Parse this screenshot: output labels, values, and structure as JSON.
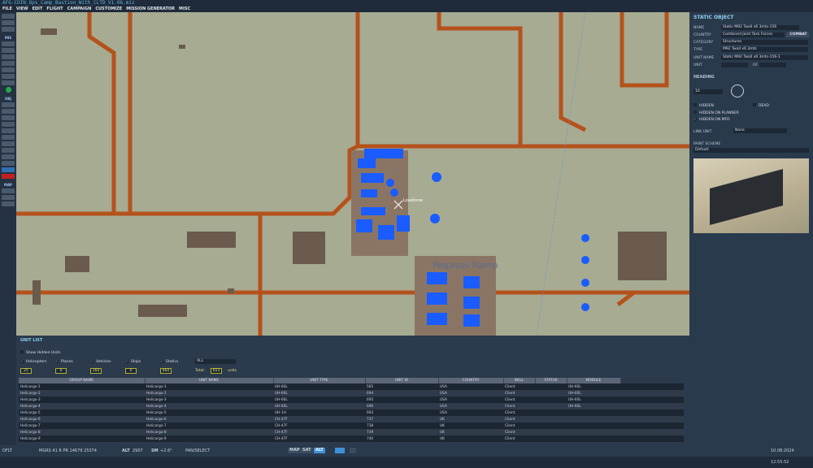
{
  "title": "AFG-COIN_Ops_Camp_Bastion_With_CLTD_V1.06.miz",
  "menu": [
    "FILE",
    "VIEW",
    "EDIT",
    "FLIGHT",
    "CAMPAIGN",
    "CUSTOMIZE",
    "MISSION GENERATOR",
    "MISC"
  ],
  "toolbar": {
    "mis_label": "MIS",
    "obj_label": "OBJ",
    "map_label": "MAP"
  },
  "map": {
    "zone_label": "Loadzone",
    "ramp_label": "Pegasus Ramp"
  },
  "static_object": {
    "title": "STATIC OBJECT",
    "name_label": "NAME",
    "name": "Static M92 Twall x6 3mts-156",
    "country_label": "COUNTRY",
    "country": "Combined Joint Task Forces",
    "combat_button": "COMBAT",
    "category_label": "CATEGORY",
    "category": "Structures",
    "type_label": "TYPE",
    "type": "M92 Twall x6 3mts",
    "unit_name_label": "UNIT NAME",
    "unit_name": "Static M92 Twall x6 3mts-156-1",
    "unit_label": "UNIT",
    "of_label": "OF",
    "heading_label": "HEADING",
    "heading": "10",
    "hidden_label": "HIDDEN",
    "dead_label": "DEAD",
    "hidden_planner_label": "HIDDEN ON PLANNER",
    "hidden_mfd_label": "HIDDEN ON MFD",
    "link_unit_label": "LINK UNIT",
    "link_unit": "None",
    "paint_label": "PAINT SCHEME",
    "paint": "Default"
  },
  "unit_list": {
    "title": "UNIT LIST",
    "show_hidden": "Show Hidden Units",
    "filters": [
      {
        "label": "Helicopters",
        "count": "25"
      },
      {
        "label": "Planes",
        "count": "0"
      },
      {
        "label": "Vehicles",
        "count": "164"
      },
      {
        "label": "Ships",
        "count": "0"
      },
      {
        "label": "Statics",
        "count": "464"
      }
    ],
    "coalition": "ALL",
    "total_label": "Total:",
    "total": "653",
    "units_label": "units",
    "columns": [
      "GROUP NAME",
      "UNIT NAME",
      "UNIT TYPE",
      "UNIT ID",
      "COUNTRY",
      "SKILL",
      "STATUS",
      "MODULE"
    ],
    "rows": [
      [
        "Helicargo-1",
        "Helicargo-1",
        "UH-60L",
        "565",
        "USA",
        "Client",
        "",
        "UH-60L"
      ],
      [
        "Helicargo-2",
        "Helicargo-2",
        "UH-60L",
        "694",
        "USA",
        "Client",
        "",
        "UH-60L"
      ],
      [
        "Helicargo-3",
        "Helicargo-3",
        "UH-60L",
        "695",
        "USA",
        "Client",
        "",
        "UH-60L"
      ],
      [
        "Helicargo-4",
        "Helicargo-4",
        "UH-60L",
        "696",
        "USA",
        "Client",
        "",
        "UH-60L"
      ],
      [
        "Helicargo-5",
        "Helicargo-5",
        "UH-1H",
        "693",
        "USA",
        "Client",
        "",
        ""
      ],
      [
        "Helicargo-6",
        "Helicargo-6",
        "CH-47F",
        "737",
        "UK",
        "Client",
        "",
        ""
      ],
      [
        "Helicargo-7",
        "Helicargo-7",
        "CH-47F",
        "738",
        "UK",
        "Client",
        "",
        ""
      ],
      [
        "Helicargo-8",
        "Helicargo-8",
        "CH-47F",
        "739",
        "UK",
        "Client",
        "",
        ""
      ],
      [
        "Helicargo-9",
        "Helicargo-9",
        "CH-47F",
        "740",
        "UK",
        "Client",
        "",
        ""
      ]
    ]
  },
  "status": {
    "profile": "DFLT",
    "mgrs": "MGRS  41 R PR 14679 25374",
    "alt_label": "ALT",
    "alt": "2907",
    "sm_label": "SM",
    "sm": "+2.6°",
    "mode": "PAN/SELECT",
    "map_btn": "MAP",
    "sat_btn": "SAT",
    "alt_btn": "ALT",
    "datetime": "10.08.2024 12:55:52"
  },
  "colors": {
    "accent": "#5fb3e0",
    "road": "#b5521c",
    "ground": "#a6ab92",
    "unit": "#1a5cff"
  }
}
